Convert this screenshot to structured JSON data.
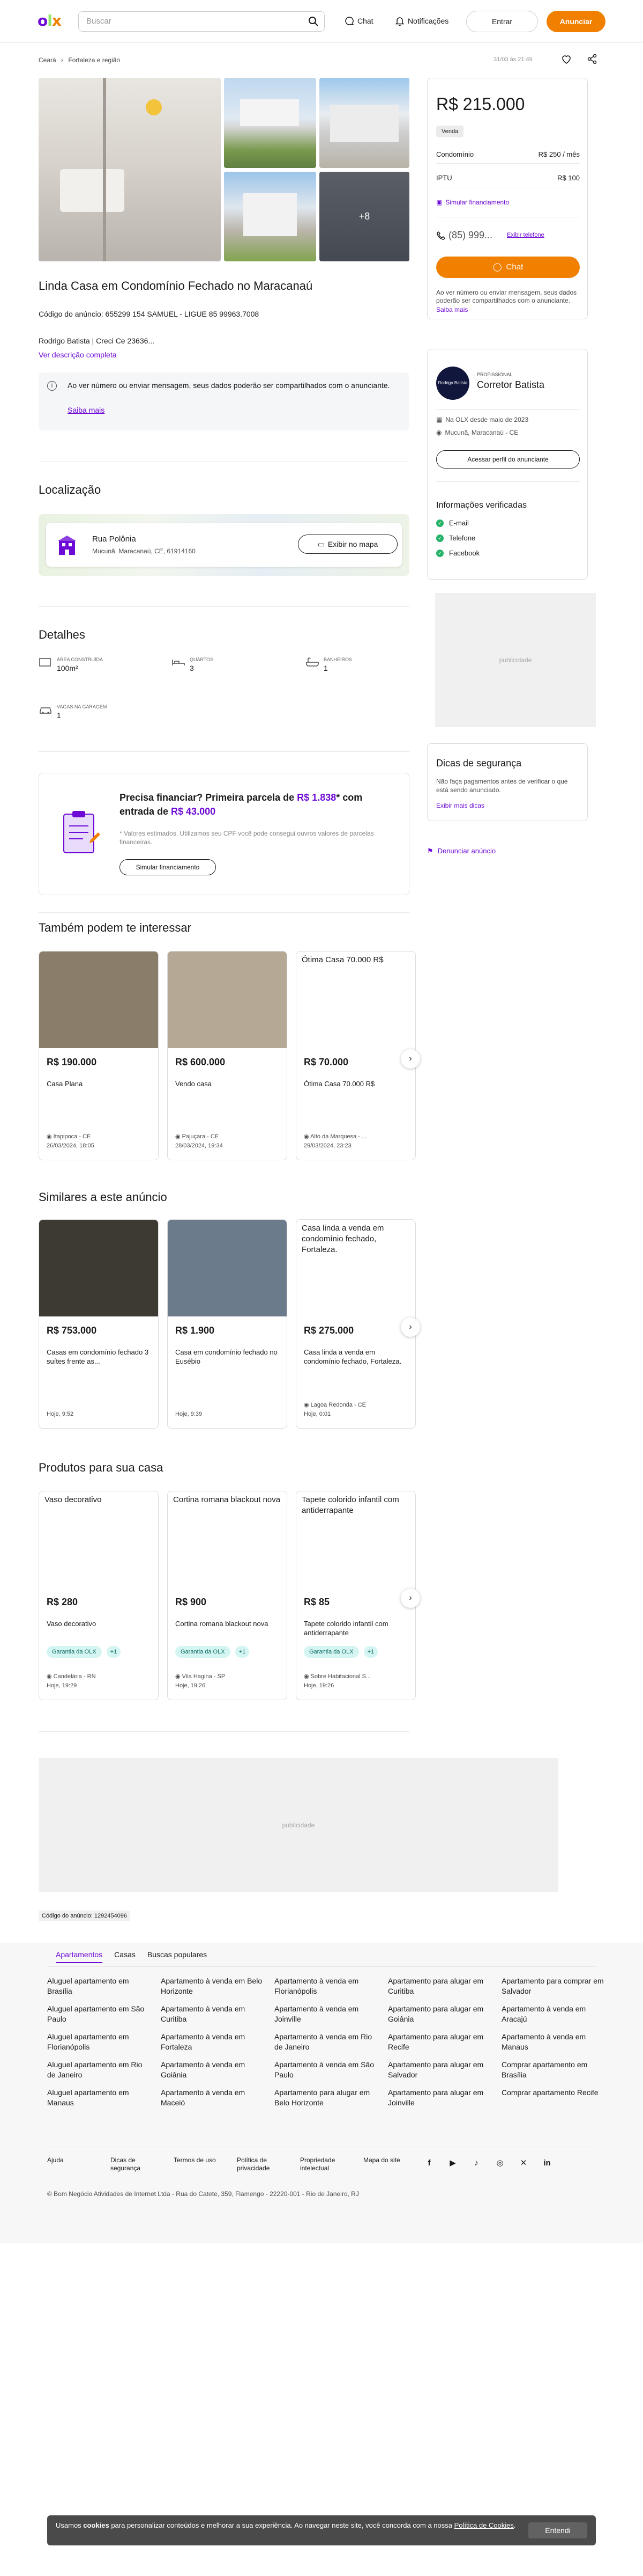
{
  "header": {
    "search_placeholder": "Buscar",
    "chat": "Chat",
    "notifications": "Notificações",
    "login": "Entrar",
    "announce": "Anunciar"
  },
  "breadcrumb": {
    "state": "Ceará",
    "region": "Fortaleza e região",
    "published": "31/03 às 21:49"
  },
  "gallery": {
    "more": "+8"
  },
  "listing": {
    "title": "Linda Casa em Condomínio Fechado no Maracanaú",
    "code": "Código do anúncio: 655299 154 SAMUEL - LIGUE 85 99963.7008",
    "realtor": "Rodrigo Batista | Creci Ce 23636...",
    "see_description": "Ver descrição completa",
    "notice_text": "Ao ver número ou enviar mensagem, seus dados poderão ser compartilhados com o anunciante.",
    "notice_link": "Saiba mais"
  },
  "location": {
    "title": "Localização",
    "street": "Rua Polônia",
    "address": "Mucunã, Maracanaú, CE, 61914160",
    "map_button": "Exibir no mapa"
  },
  "details": {
    "title": "Detalhes",
    "items": [
      {
        "label": "ÁREA CONSTRUÍDA",
        "value": "100m²",
        "icon": "area-icon"
      },
      {
        "label": "QUARTOS",
        "value": "3",
        "icon": "bed-icon"
      },
      {
        "label": "BANHEIROS",
        "value": "1",
        "icon": "bathtub-icon"
      },
      {
        "label": "VAGAS NA GARAGEM",
        "value": "1",
        "icon": "car-icon"
      }
    ]
  },
  "finance": {
    "title_a": "Precisa financiar? Primeira parcela de ",
    "first_installment": "R$ 1.838",
    "title_b": "* com entrada de ",
    "down_payment": "R$ 43.000",
    "note": "* Valores estimados. Utilizamos seu CPF você pode consegui ouvros valores de parcelas financeiras.",
    "button": "Simular financiamento"
  },
  "interest": {
    "title": "Também podem te interessar",
    "cards": [
      {
        "price": "R$ 190.000",
        "name": "Casa Plana",
        "location": "Itapipoca - CE",
        "date": "26/03/2024, 18:05",
        "img": "#8a7d6a"
      },
      {
        "price": "R$ 600.000",
        "name": "Vendo casa",
        "location": "Pajuçara - CE",
        "date": "28/03/2024, 19:34",
        "img": "#b5a895"
      },
      {
        "price": "R$ 70.000",
        "name": "Ótima Casa 70.000 R$",
        "location": "Alto da Marquesa - ...",
        "date": "29/03/2024, 23:23",
        "img": "",
        "noimg": "Ótima Casa 70.000 R$"
      }
    ]
  },
  "similar": {
    "title": "Similares a este anúncio",
    "cards": [
      {
        "price": "R$ 753.000",
        "name": "Casas em condomínio fechado 3 suítes frente as...",
        "location": "",
        "date": "Hoje, 9:52",
        "img": "#3d3a33"
      },
      {
        "price": "R$ 1.900",
        "name": "Casa em condomínio fechado no Eusébio",
        "location": "",
        "date": "Hoje, 9:39",
        "img": "#6c7b8c"
      },
      {
        "price": "R$ 275.000",
        "name": "Casa linda a venda em condomínio fechado, Fortaleza.",
        "location": "Lagoa Redonda - CE",
        "date": "Hoje, 0:01",
        "img": "",
        "noimg": "Casa linda a venda em condomínio fechado, Fortaleza."
      }
    ]
  },
  "products": {
    "title": "Produtos para sua casa",
    "badge": "Garantia da OLX",
    "badge_plus": "+1",
    "cards": [
      {
        "price": "R$ 280",
        "name": "Vaso decorativo",
        "location": "Candelária - RN",
        "date": "Hoje, 19:29",
        "noimg": "Vaso decorativo"
      },
      {
        "price": "R$ 900",
        "name": "Cortina romana blackout nova",
        "location": "Vila Hagina - SP",
        "date": "Hoje, 19:26",
        "noimg": "Cortina romana blackout nova"
      },
      {
        "price": "R$ 85",
        "name": "Tapete colorido infantil com antiderrapante",
        "location": "Sobre Habitacional S...",
        "date": "Hoje, 19:26",
        "noimg": "Tapete colorido infantil com antiderrapante"
      }
    ]
  },
  "ads": {
    "label": "publicidade"
  },
  "ad_code": "Código do anúncio: 1292454096",
  "sidebar": {
    "price": "R$ 215.000",
    "type": "Venda",
    "condo_label": "Condomínio",
    "condo_value": "R$ 250 / mês",
    "iptu_label": "IPTU",
    "iptu_value": "R$ 100",
    "simulate": "Simular financiamento",
    "phone": "(85) 999...",
    "show_phone": "Exibir telefone",
    "chat": "Chat",
    "notice": "Ao ver número ou enviar mensagem, seus dados poderão ser compartilhados com o anunciante.",
    "notice_link": "Saiba mais",
    "pro_label": "PROFISSIONAL",
    "seller": "Corretor Batista",
    "since": "Na OLX desde maio de 2023",
    "seller_location": "Mucunã, Maracanaú - CE",
    "profile_button": "Acessar perfil do anunciante",
    "verified_title": "Informações verificadas",
    "verified": [
      "E-mail",
      "Telefone",
      "Facebook"
    ],
    "safety_title": "Dicas de segurança",
    "safety_text": "Não faça pagamentos antes de verificar o que está sendo anunciado.",
    "safety_link": "Exibir mais dicas",
    "report": "Denunciar anúncio",
    "avatar_text": "Rodrigo Batista"
  },
  "footer": {
    "tabs": [
      "Apartamentos",
      "Casas",
      "Buscas populares"
    ],
    "links": [
      "Aluguel apartamento em Brasília",
      "Apartamento à venda em Belo Horizonte",
      "Apartamento à venda em Florianópolis",
      "Apartamento para alugar em Curitiba",
      "Apartamento para comprar em Salvador",
      "Aluguel apartamento em São Paulo",
      "Apartamento à venda em Curitiba",
      "Apartamento à venda em Joinville",
      "Apartamento para alugar em Goiânia",
      "Apartamento à venda em Aracajú",
      "Aluguel apartamento em Florianópolis",
      "Apartamento à venda em Fortaleza",
      "Apartamento à venda em Rio de Janeiro",
      "Apartamento para alugar em Recife",
      "Apartamento à venda em Manaus",
      "Aluguel apartamento em Rio de Janeiro",
      "Apartamento à venda em Goiânia",
      "Apartamento à venda em São Paulo",
      "Apartamento para alugar em Salvador",
      "Comprar apartamento em Brasília",
      "Aluguel apartamento em Manaus",
      "Apartamento à venda em Maceió",
      "Apartamento para alugar em Belo Horizonte",
      "Apartamento para alugar em Joinville",
      "Comprar apartamento Recife"
    ],
    "bottom_links": [
      "Ajuda",
      "Dicas de segurança",
      "Termos de uso",
      "Política de privacidade",
      "Propriedade intelectual",
      "Mapa do site"
    ],
    "copyright": "© Bom Negócio Atividades de Internet Ltda - Rua do Catete, 359, Flamengo - 22220-001 - Rio de Janeiro, RJ"
  },
  "cookie": {
    "text_a": "Usamos ",
    "bold": "cookies",
    "text_b": " para personalizar conteúdos e melhorar a sua experiência. Ao navegar neste site, você concorda com a nossa ",
    "policy": "Política de Cookies",
    "end": ".",
    "button": "Entendi"
  }
}
